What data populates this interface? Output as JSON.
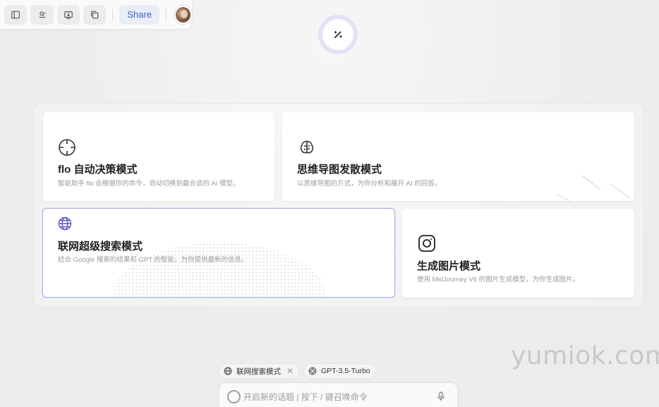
{
  "toolbar": {
    "buttons": [
      {
        "icon": "sidebar-icon"
      },
      {
        "icon": "search-list-icon"
      },
      {
        "icon": "screen-download-icon"
      },
      {
        "icon": "copy-icon"
      }
    ],
    "share_label": "Share",
    "accent": "#3a64c2"
  },
  "wand": {
    "icon": "magic-wand-icon",
    "ring_color": "#e4e1f6"
  },
  "modes": {
    "flo": {
      "icon": "crosshair-icon",
      "title": "flo 自动决策模式",
      "desc": "智能助手 flo 会根据你的命令，自动切换到最合适的 AI 模型。"
    },
    "mind": {
      "icon": "brain-icon",
      "title": "思维导图发散模式",
      "desc": "以思维导图的方式，为你分析和展开 AI 的回答。"
    },
    "web": {
      "icon": "globe-icon",
      "title": "联网超级搜索模式",
      "desc": "结合 Google 搜索的结果和 GPT 的智能，为你提供最新的信息。",
      "selected": true
    },
    "image": {
      "icon": "instagram-icon",
      "title": "生成图片模式",
      "desc": "使用 MidJourney V6 的图片生成模型，为你生成图片。"
    }
  },
  "chips": {
    "mode_label": "联网搜索模式",
    "model_label": "GPT-3.5-Turbo"
  },
  "input": {
    "placeholder": "开启新的话题 | 按下 / 键召唤命令"
  },
  "watermark": "yumiok.com"
}
